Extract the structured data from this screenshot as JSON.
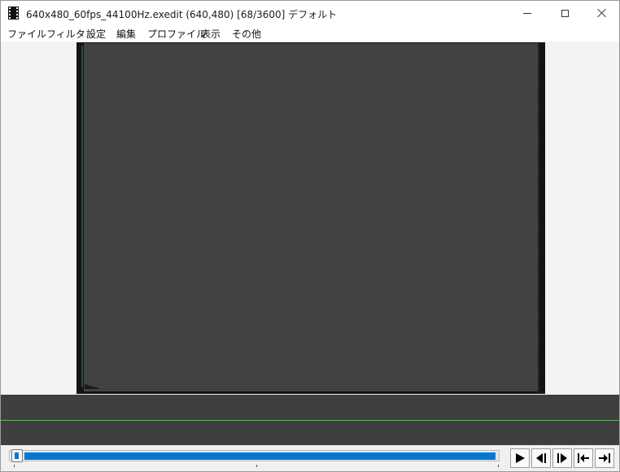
{
  "window": {
    "title": "640x480_60fps_44100Hz.exedit (640,480)  [68/3600]  デフォルト",
    "buttons": {
      "minimize_icon": "minimize-icon",
      "maximize_icon": "maximize-icon",
      "close_icon": "close-icon"
    }
  },
  "menubar": {
    "items": [
      "ファイル",
      "フィルタ",
      "設定",
      "編集",
      "プロファイル",
      "表示",
      "その他"
    ]
  },
  "playback": {
    "current_frame": 68,
    "total_frames": 3600,
    "progress_fraction": 0.019
  },
  "controls": {
    "play_icon": "play-icon",
    "prev_frame_icon": "previous-frame-icon",
    "next_frame_icon": "next-frame-icon",
    "go_start_icon": "go-to-start-icon",
    "go_end_icon": "go-to-end-icon"
  },
  "colors": {
    "accent": "#0078d4",
    "timeline_bg": "#3f3f3f",
    "timeline_cursor": "#33d633",
    "video_bg": "#404040"
  }
}
